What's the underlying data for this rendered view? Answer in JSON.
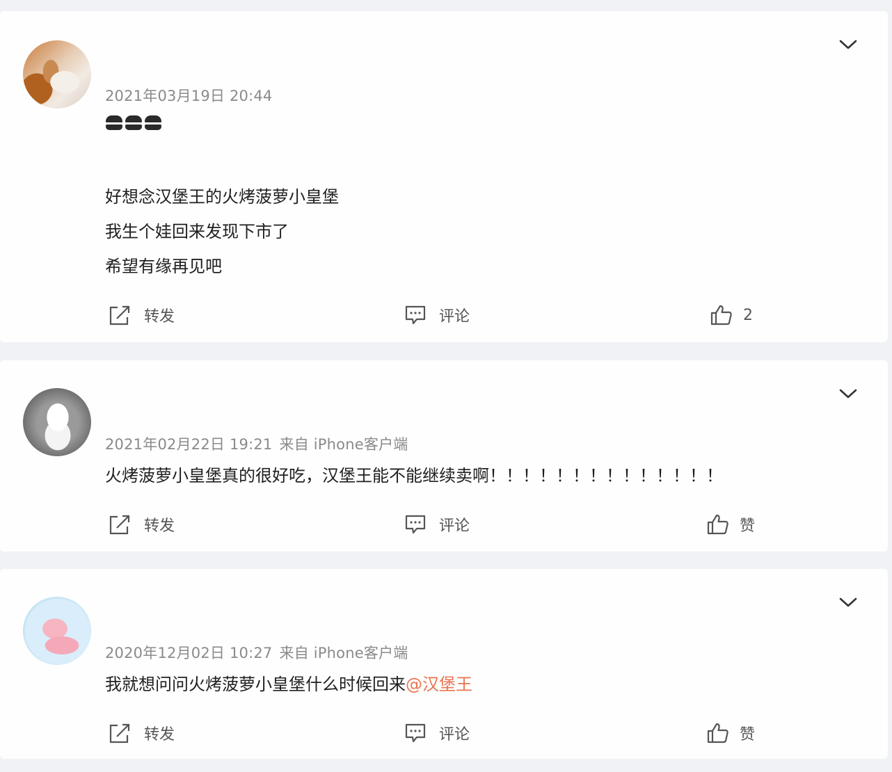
{
  "posts": [
    {
      "avatar": "avatar-orange-cat",
      "timestamp": "2021年03月19日 20:44",
      "source": "",
      "emoji": [
        "hamburger",
        "hamburger",
        "hamburger"
      ],
      "lines": [
        "好想念汉堡王的火烤菠萝小皇堡",
        "我生个娃回来发现下市了",
        "希望有缘再见吧"
      ],
      "actions": {
        "repost": "转发",
        "comment": "评论",
        "like": "2"
      }
    },
    {
      "avatar": "avatar-white-dog",
      "timestamp": "2021年02月22日 19:21",
      "source": "来自 iPhone客户端",
      "text": "火烤菠萝小皇堡真的很好吃，汉堡王能不能继续卖啊！！！！！！！！！！！！！！",
      "actions": {
        "repost": "转发",
        "comment": "评论",
        "like": "赞"
      }
    },
    {
      "avatar": "avatar-pink-pig",
      "timestamp": "2020年12月02日 10:27",
      "source": "来自 iPhone客户端",
      "text": "我就想问问火烤菠萝小皇堡什么时候回来",
      "mention": "@汉堡王",
      "actions": {
        "repost": "转发",
        "comment": "评论",
        "like": "赞"
      }
    }
  ],
  "colors": {
    "background": "#f1f2f5",
    "card": "#fefefe",
    "text": "#1f1f1f",
    "meta": "#8a8a8a",
    "mention": "#eb7350",
    "icon": "#555555"
  },
  "icons": {
    "menu": "chevron-down-icon",
    "repost": "share-icon",
    "comment": "comment-icon",
    "like": "thumbs-up-icon",
    "emoji": "hamburger-icon"
  }
}
